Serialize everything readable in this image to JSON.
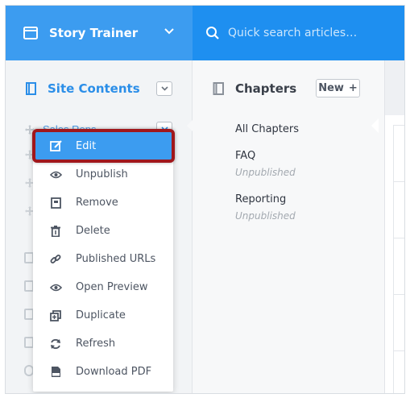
{
  "header": {
    "site_title": "Story Trainer",
    "search_placeholder": "Quick search articles…"
  },
  "sidebar": {
    "title": "Site Contents",
    "selected_category": "Sales Reps"
  },
  "menu": {
    "items": [
      {
        "label": "Edit",
        "icon": "edit-icon",
        "active": true
      },
      {
        "label": "Unpublish",
        "icon": "eye-icon"
      },
      {
        "label": "Remove",
        "icon": "remove-icon"
      },
      {
        "label": "Delete",
        "icon": "trash-icon"
      },
      {
        "label": "Published URLs",
        "icon": "link-icon"
      },
      {
        "label": "Open Preview",
        "icon": "eye-icon"
      },
      {
        "label": "Duplicate",
        "icon": "duplicate-icon"
      },
      {
        "label": "Refresh",
        "icon": "refresh-icon"
      },
      {
        "label": "Download PDF",
        "icon": "pdf-icon"
      }
    ]
  },
  "chapters": {
    "title": "Chapters",
    "new_button": "New",
    "items": [
      {
        "label": "All Chapters",
        "status": ""
      },
      {
        "label": "FAQ",
        "status": "Unpublished"
      },
      {
        "label": "Reporting",
        "status": "Unpublished"
      }
    ]
  },
  "colors": {
    "brand": "#3c9cf0",
    "search_bar": "#1e8ff0",
    "highlight": "#a0171c"
  }
}
